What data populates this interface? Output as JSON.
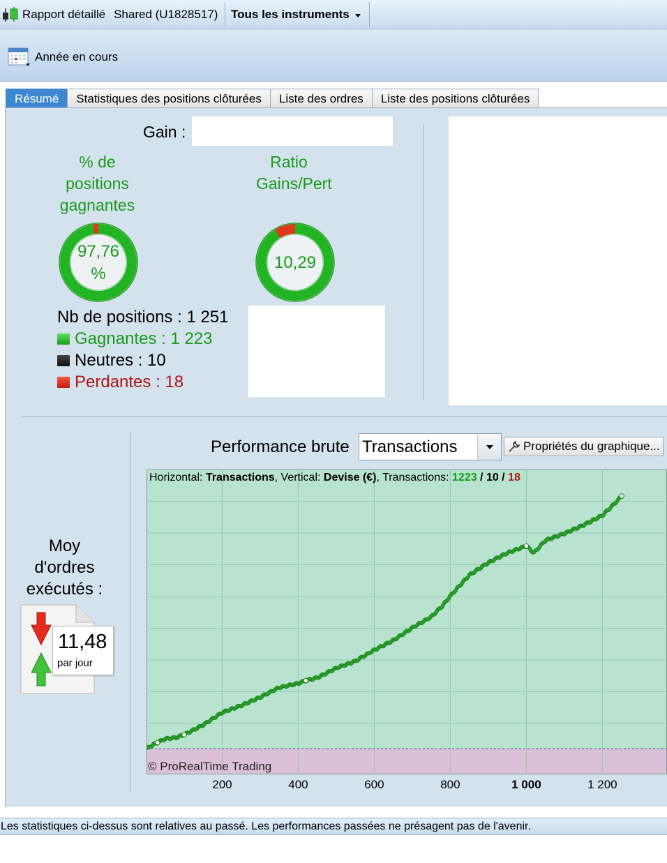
{
  "toolbar": {
    "report_label": "Rapport détaillé",
    "account_label": "Shared (U1828517)",
    "instruments_label": "Tous les instruments"
  },
  "period": {
    "label": "Année en cours"
  },
  "tabs": [
    {
      "label": "Résumé",
      "active": true
    },
    {
      "label": "Statistiques des positions clôturées",
      "active": false
    },
    {
      "label": "Liste des ordres",
      "active": false
    },
    {
      "label": "Liste des positions clôturées",
      "active": false
    }
  ],
  "summary": {
    "gain_label": "Gain :",
    "win_pct": {
      "title_lines": [
        "% de",
        "positions",
        "gagnantes"
      ],
      "value_line1": "97,76",
      "value_line2": "%",
      "fraction": 0.9776
    },
    "ratio": {
      "title_lines": [
        "Ratio",
        "Gains/Pert"
      ],
      "value": "10,29",
      "gain_fraction": 0.9114
    },
    "positions_count": "Nb de positions : 1 251",
    "winning": "Gagnantes : 1 223",
    "neutral": "Neutres : 10",
    "losing": "Perdantes : 18"
  },
  "avg_orders": {
    "title_lines": [
      "Moy",
      "d'ordres",
      "exécutés :"
    ],
    "value": "11,48",
    "unit": "par jour"
  },
  "performance": {
    "label": "Performance brute",
    "selected": "Transactions",
    "properties_button": "Propriétés du graphique..."
  },
  "chart_data": {
    "type": "line",
    "header": {
      "h_label": "Horizontal:",
      "h_value": "Transactions",
      "sep1": ", Vertical:",
      "v_value": "Devise (€)",
      "sep2": ", Transactions:",
      "wins": "1223",
      "slash1": " / ",
      "neutral": "10",
      "slash2": " / ",
      "losses": "18"
    },
    "watermark": "© ProRealTime Trading",
    "xlabel": "",
    "ylabel": "",
    "x_ticks": [
      "200",
      "400",
      "600",
      "800",
      "1 000",
      "1 200"
    ],
    "x_tick_values": [
      200,
      400,
      600,
      800,
      1000,
      1200
    ],
    "bold_tick": "1 000",
    "xlim": [
      1,
      1370
    ],
    "ylim": [
      0,
      100
    ],
    "note": "",
    "series": [
      {
        "x": [
          1,
          20,
          50,
          80,
          100,
          150,
          200,
          250,
          300,
          350,
          400,
          420,
          450,
          500,
          550,
          600,
          650,
          700,
          750,
          780,
          800,
          830,
          850,
          900,
          950,
          990,
          1000,
          1020,
          1050,
          1100,
          1150,
          1200,
          1230,
          1251
        ],
        "y": [
          0,
          3,
          7,
          8,
          10,
          17,
          26,
          31,
          37,
          44,
          47,
          49,
          51,
          58,
          63,
          71,
          78,
          87,
          95,
          103,
          110,
          119,
          125,
          134,
          141,
          145,
          146,
          141,
          150,
          155,
          161,
          168,
          176,
          182
        ]
      }
    ]
  },
  "colors": {
    "accent_tab": "#3d86d2",
    "win_green": "#1a9a1a",
    "loss_red": "#b01414",
    "chart_bg_positive": "#b7e3cf",
    "chart_bg_negative": "#dcc0d8"
  },
  "status": {
    "text": "Les statistiques ci-dessus sont relatives au passé. Les performances passées ne présagent pas de l'avenir."
  }
}
